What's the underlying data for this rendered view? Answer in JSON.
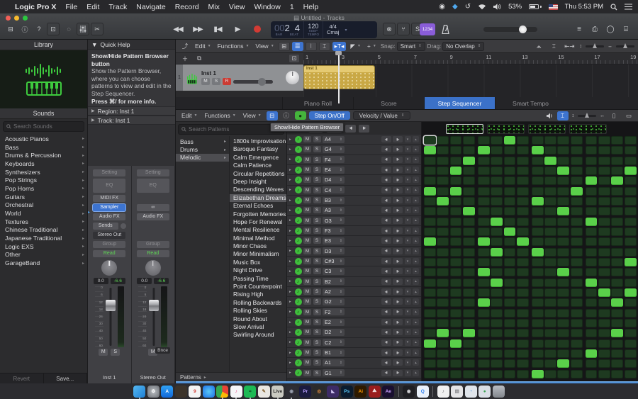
{
  "icons": {
    "apple": "",
    "chev_down": "▾",
    "chev_right": "▸",
    "chev_up": "▴",
    "stepper": "⇕",
    "note": "♪",
    "rotate_left": "◂▮",
    "rotate_right": "▮▸",
    "cycle": "↻",
    "infinity": "∞"
  },
  "menu_bar": {
    "app": "Logic Pro X",
    "items": [
      "File",
      "Edit",
      "Track",
      "Navigate",
      "Record",
      "Mix",
      "View",
      "Window",
      "1",
      "Help"
    ],
    "status": {
      "battery": "53%",
      "clock": "Thu 5:53 PM"
    }
  },
  "window": {
    "title": "Untitled - Tracks"
  },
  "transport": {
    "lcd": {
      "bar_dim": "00",
      "bar": "2",
      "beat": "4",
      "bar_label": "BAR",
      "beat_label": "BEAT",
      "tempo": "120",
      "tempo_label1": "KEEP",
      "tempo_label2": "TEMPO",
      "signature": "4/4",
      "key": "Cmaj"
    },
    "count_in": "1234",
    "solo_label": "S"
  },
  "library": {
    "title": "Library",
    "sounds_label": "Sounds",
    "search_placeholder": "Search Sounds",
    "items": [
      "Acoustic Pianos",
      "Bass",
      "Drums & Percussion",
      "Keyboards",
      "Synthesizers",
      "Pop Strings",
      "Pop Horns",
      "Guitars",
      "Orchestral",
      "World",
      "Textures",
      "Chinese Traditional",
      "Japanese Traditional",
      "Logic EXS",
      "Other",
      "GarageBand"
    ],
    "revert": "Revert",
    "save": "Save..."
  },
  "quick_help": {
    "title": "Quick Help",
    "heading": "Show/Hide Pattern Browser button",
    "body": "Show the Pattern Browser, where you can choose patterns to view and edit in the Step Sequencer.",
    "more": "Press ⌘/ for more info.",
    "region": "Region: Inst 1",
    "track": "Track: Inst 1"
  },
  "inspector": {
    "fader_scale": [
      "0",
      "6",
      "12",
      "18",
      "24",
      "30",
      "40",
      "50",
      "60"
    ],
    "strip1": {
      "setting": "Setting",
      "eq": "EQ",
      "midi_fx": "MIDI FX",
      "sampler": "Sampler",
      "audio_fx": "Audio FX",
      "sends": "Sends",
      "output": "Stereo Out",
      "group": "Group",
      "automation": "Read",
      "pan": "0.0",
      "volume": "-6.6",
      "mute": "M",
      "solo": "S",
      "name": "Inst 1"
    },
    "strip2": {
      "setting": "Setting",
      "eq": "EQ",
      "audio_fx": "Audio FX",
      "group": "Group",
      "automation": "Read",
      "pan": "0.0",
      "volume": "-6.6",
      "bounce": "Bnce",
      "mute": "M",
      "name": "Stereo Out"
    }
  },
  "tracks": {
    "menus": [
      "Edit",
      "Functions",
      "View"
    ],
    "snap_label": "Snap:",
    "snap_value": "Smart",
    "drag_label": "Drag:",
    "drag_value": "No Overlap",
    "ruler": [
      "1",
      "3",
      "5",
      "7",
      "9",
      "11",
      "13",
      "15",
      "17",
      "19"
    ],
    "track": {
      "num": "1",
      "name": "Inst 1",
      "mute": "M",
      "solo": "S",
      "record": "R"
    },
    "region_name": "Inst 1"
  },
  "editor": {
    "tabs": [
      {
        "label": "Piano Roll",
        "active": false
      },
      {
        "label": "Score",
        "active": false
      },
      {
        "label": "Step Sequencer",
        "active": true
      },
      {
        "label": "Smart Tempo",
        "active": false
      }
    ],
    "toolbar": {
      "menus": [
        "Edit",
        "Functions",
        "View"
      ],
      "step_onoff": "Step On/Off",
      "mode": "Velocity / Value"
    },
    "tooltip": "Show/Hide Pattern Browser",
    "browser": {
      "search_placeholder": "Search Patterns",
      "categories": [
        "Bass",
        "Drums",
        "Melodic"
      ],
      "selected_category": "Melodic",
      "patterns": [
        "1800s Improvisation",
        "Baroque Fantasy",
        "Calm Emergence",
        "Calm Patience",
        "Circular Repetitions",
        "Deep Insight",
        "Descending Waves",
        "Elizabethan Dreams",
        "Eternal Echoes",
        "Forgotten Memories",
        "Hope For Renewal",
        "Mental Resilience",
        "Minimal Method",
        "Minor Chaos",
        "Minor Minimalism",
        "Music Box",
        "Night Drive",
        "Passing Time",
        "Point Counterpoint",
        "Rising High",
        "Rolling Backwards",
        "Rolling Skies",
        "Round About",
        "Slow Arrival",
        "Swirling Around"
      ],
      "selected_pattern": "Elizabethan Dreams",
      "footer": "Patterns"
    },
    "rows_header": {
      "rate": "/8",
      "direction": "→",
      "mute": "M",
      "solo": "S"
    },
    "grid": {
      "columns": 16,
      "selected_cell": {
        "row": 0,
        "col": 1
      },
      "active_color": "#5ad04a"
    },
    "rows": [
      {
        "note": "A4",
        "steps": [
          7
        ]
      },
      {
        "note": "G4",
        "steps": [
          1,
          5,
          9
        ]
      },
      {
        "note": "F4",
        "steps": [
          4,
          10
        ]
      },
      {
        "note": "E4",
        "steps": [
          3,
          11,
          16
        ]
      },
      {
        "note": "D4",
        "steps": [
          13,
          15
        ]
      },
      {
        "note": "C4",
        "steps": [
          1,
          3,
          12
        ]
      },
      {
        "note": "B3",
        "steps": [
          2,
          9
        ]
      },
      {
        "note": "A3",
        "steps": [
          4,
          11
        ]
      },
      {
        "note": "G3",
        "steps": [
          6,
          13
        ]
      },
      {
        "note": "F3",
        "steps": [
          7
        ]
      },
      {
        "note": "E3",
        "steps": [
          1,
          5,
          8
        ]
      },
      {
        "note": "D3",
        "steps": [
          6,
          9
        ]
      },
      {
        "note": "C#3",
        "steps": [
          16
        ]
      },
      {
        "note": "C3",
        "steps": [
          5,
          11
        ]
      },
      {
        "note": "B2",
        "steps": [
          6,
          13
        ]
      },
      {
        "note": "A2",
        "steps": [
          14,
          16
        ]
      },
      {
        "note": "G2",
        "steps": [
          5,
          15
        ]
      },
      {
        "note": "F2",
        "steps": []
      },
      {
        "note": "E2",
        "steps": []
      },
      {
        "note": "D2",
        "steps": [
          2,
          4,
          15
        ]
      },
      {
        "note": "C2",
        "steps": [
          1,
          3
        ]
      },
      {
        "note": "B1",
        "steps": [
          13
        ]
      },
      {
        "note": "A1",
        "steps": [
          11
        ]
      },
      {
        "note": "G1",
        "steps": [
          9
        ]
      }
    ]
  },
  "dock": {
    "apps": [
      {
        "name": "finder",
        "bg": "linear-gradient(135deg,#55b9f2,#1e7fd4)",
        "label": "",
        "running": true
      },
      {
        "name": "system-preferences",
        "bg": "radial-gradient(#babec3,#6b6f75)",
        "label": "⚙",
        "running": false
      },
      {
        "name": "app-store",
        "bg": "linear-gradient(#30a2f5,#1268d8)",
        "label": "A",
        "running": false
      },
      {
        "name": "photos",
        "bg": "#3b332a",
        "label": "",
        "running": false
      },
      {
        "name": "calendar",
        "bg": "#f4f4f4",
        "fg": "#d23b34",
        "label": "9",
        "running": false
      },
      {
        "name": "safari",
        "bg": "radial-gradient(#5bc8f5,#1c6fe8)",
        "label": "",
        "running": false
      },
      {
        "name": "chrome",
        "bg": "conic-gradient(#ea4335 0 33%,#fbbc05 33% 55%,#34a853 55% 100%)",
        "label": "",
        "running": true
      },
      {
        "name": "itunes",
        "bg": "#f6f6f8",
        "fg": "#e84a86",
        "label": "♪",
        "running": true
      },
      {
        "name": "spotify",
        "bg": "#1db954",
        "fg": "#0e2a16",
        "label": "≈",
        "running": true
      },
      {
        "name": "textedit",
        "bg": "#e9e7e2",
        "fg": "#8a6a3a",
        "label": "✎",
        "running": false
      },
      {
        "name": "ableton-live",
        "bg": "#c9c9c1",
        "fg": "#2c2c2c",
        "label": "Live",
        "running": true
      },
      {
        "name": "audio-utility",
        "bg": "#2e2e35",
        "fg": "#9aa0ae",
        "label": "◉",
        "running": true
      },
      {
        "name": "premiere",
        "bg": "#1b1b40",
        "fg": "#b9a0ff",
        "label": "Pr",
        "running": false
      },
      {
        "name": "davinci-resolve",
        "bg": "#2b2b2b",
        "fg": "#e08a3c",
        "label": "◎",
        "running": false
      },
      {
        "name": "media-app",
        "bg": "#3d2b66",
        "fg": "#cfc2f0",
        "label": "◣",
        "running": false
      },
      {
        "name": "photoshop",
        "bg": "#0b1c2e",
        "fg": "#5ac8fa",
        "label": "Ps",
        "running": false
      },
      {
        "name": "illustrator",
        "bg": "#2e1a00",
        "fg": "#ff9a00",
        "label": "Ai",
        "running": false
      },
      {
        "name": "acrobat",
        "bg": "#9a1d1d",
        "fg": "#ffffff",
        "label": "⟁",
        "running": false
      },
      {
        "name": "after-effects",
        "bg": "#1a1030",
        "fg": "#c9a0ff",
        "label": "Ae",
        "running": false
      },
      {
        "name": "obs",
        "bg": "#1f1f23",
        "fg": "#cfcfd2",
        "label": "◉",
        "running": false
      },
      {
        "name": "quicktime",
        "bg": "#eaf1fb",
        "fg": "#2d7ff0",
        "label": "Q",
        "running": false
      },
      {
        "name": "file-music",
        "bg": "#f1f1f1",
        "fg": "#6a6a6e",
        "label": "♪",
        "running": false
      },
      {
        "name": "file-documents",
        "bg": "#e4e4e6",
        "fg": "#8a8a8e",
        "label": "▤",
        "running": false
      },
      {
        "name": "folder-downloads",
        "bg": "#dfe4ea",
        "fg": "#4a90d9",
        "label": "◔",
        "running": false
      },
      {
        "name": "folder-green",
        "bg": "#d9dee5",
        "fg": "#3da353",
        "label": "●",
        "running": false
      },
      {
        "name": "trash",
        "bg": "linear-gradient(#b9bdc3,#82868c)",
        "fg": "#f0f0f2",
        "label": "",
        "running": false
      }
    ]
  }
}
